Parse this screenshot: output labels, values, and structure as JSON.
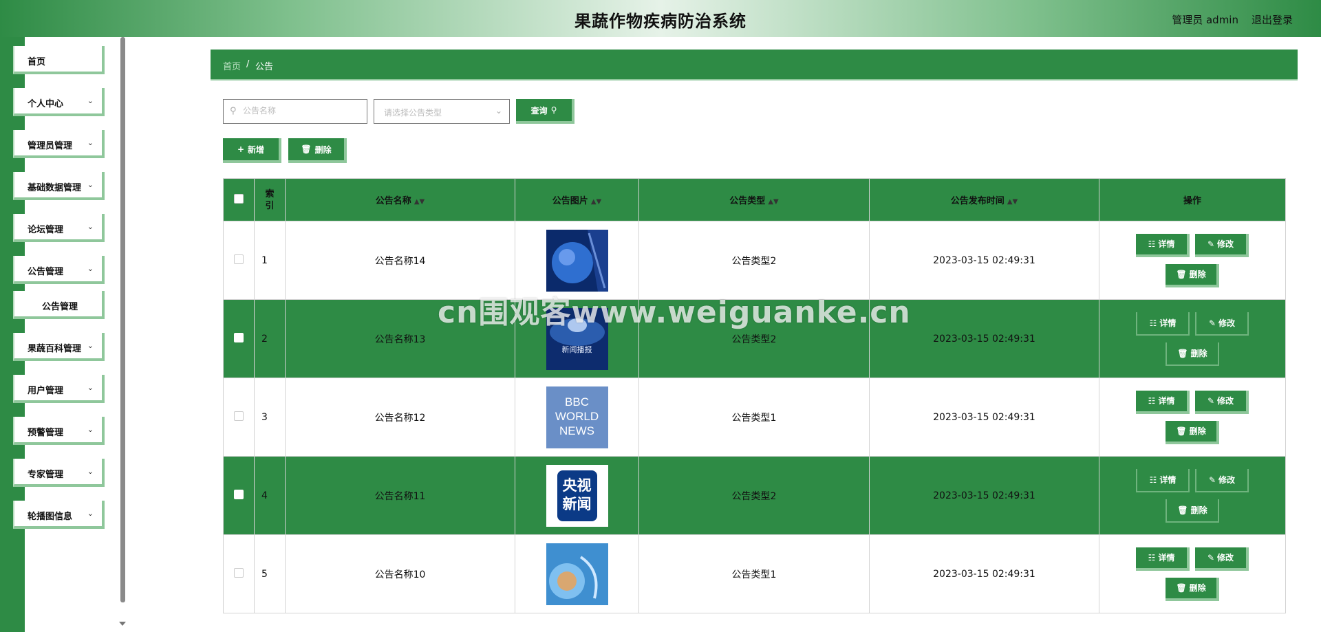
{
  "header": {
    "title": "果蔬作物疾病防治系统",
    "user": "管理员 admin",
    "logout": "退出登录"
  },
  "sidebar": {
    "items": [
      {
        "label": "首页",
        "has_children": false
      },
      {
        "label": "个人中心",
        "has_children": true
      },
      {
        "label": "管理员管理",
        "has_children": true
      },
      {
        "label": "基础数据管理",
        "has_children": true
      },
      {
        "label": "论坛管理",
        "has_children": true
      },
      {
        "label": "公告管理",
        "has_children": true
      },
      {
        "label": "公告管理",
        "sub": true
      },
      {
        "label": "果蔬百科管理",
        "has_children": true
      },
      {
        "label": "用户管理",
        "has_children": true
      },
      {
        "label": "预警管理",
        "has_children": true
      },
      {
        "label": "专家管理",
        "has_children": true
      },
      {
        "label": "轮播图信息",
        "has_children": true
      }
    ]
  },
  "breadcrumb": {
    "home": "首页",
    "separator": "/",
    "current": "公告"
  },
  "search": {
    "name_placeholder": "公告名称",
    "type_placeholder": "请选择公告类型",
    "query_label": "查询"
  },
  "actions": {
    "add_label": "新增",
    "delete_label": "删除"
  },
  "table": {
    "headers": {
      "index": "索引",
      "name": "公告名称",
      "image": "公告图片",
      "type": "公告类型",
      "time": "公告发布时间",
      "ops": "操作"
    },
    "op_labels": {
      "detail": "详情",
      "edit": "修改",
      "delete": "删除"
    },
    "rows": [
      {
        "index": "1",
        "name": "公告名称14",
        "type": "公告类型2",
        "time": "2023-03-15 02:49:31",
        "image": "globe-image"
      },
      {
        "index": "2",
        "name": "公告名称13",
        "type": "公告类型2",
        "time": "2023-03-15 02:49:31",
        "image": "news-broadcast-image",
        "image_text": "新闻播报"
      },
      {
        "index": "3",
        "name": "公告名称12",
        "type": "公告类型1",
        "time": "2023-03-15 02:49:31",
        "image": "bbc-world-news-logo",
        "image_text": "BBC WORLD NEWS"
      },
      {
        "index": "4",
        "name": "公告名称11",
        "type": "公告类型2",
        "time": "2023-03-15 02:49:31",
        "image": "cctv-news-logo",
        "image_text": "央视新闻"
      },
      {
        "index": "5",
        "name": "公告名称10",
        "type": "公告类型1",
        "time": "2023-03-15 02:49:31",
        "image": "news-globe-image"
      }
    ]
  },
  "watermark": "cn围观客www.weiguanke.cn",
  "colors": {
    "primary": "#2e8b45",
    "accent_border": "#8fc79b"
  }
}
